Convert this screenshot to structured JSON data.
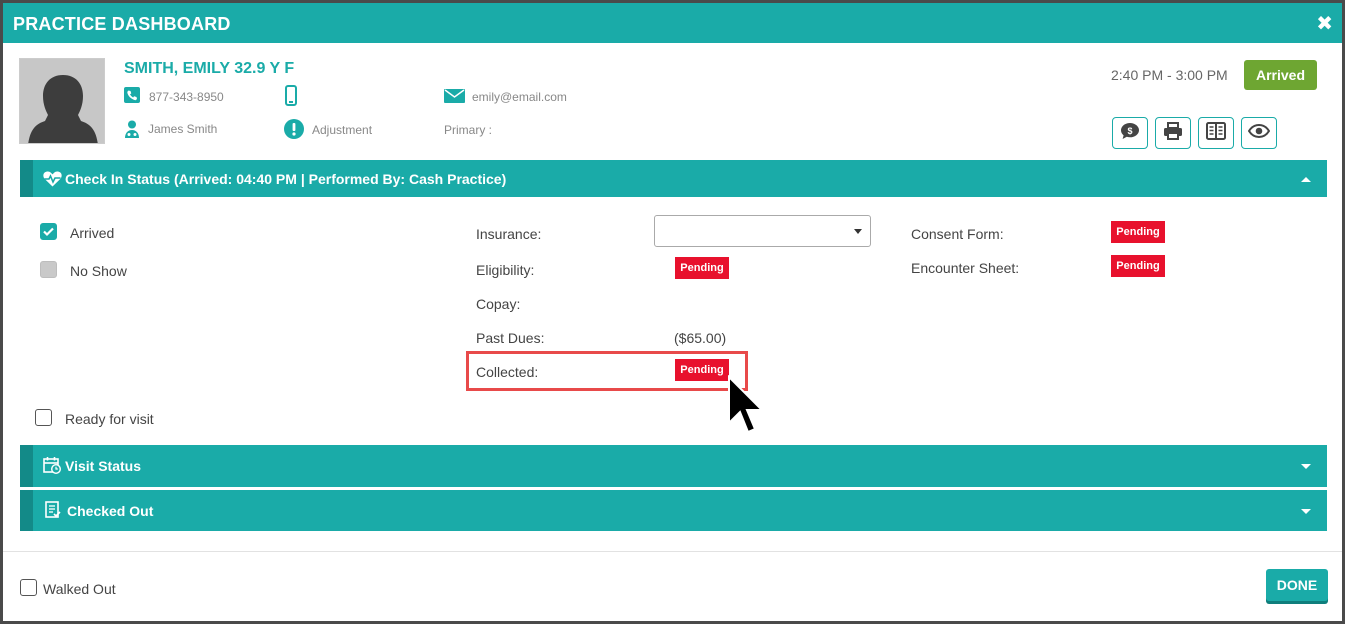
{
  "window": {
    "title": "PRACTICE DASHBOARD",
    "close_icon": "close-icon"
  },
  "patient": {
    "name": "SMITH, EMILY 32.9 Y F",
    "phone": "877-343-8950",
    "email": "emily@email.com",
    "provider": "James Smith",
    "alert_label": "Adjustment",
    "primary_label": "Primary :"
  },
  "appointment": {
    "time": "2:40 PM - 3:00 PM",
    "status": "Arrived",
    "status_color": "#6ea632"
  },
  "toolbar": {
    "buttons": [
      {
        "icon": "dollar-chat-icon"
      },
      {
        "icon": "printer-icon"
      },
      {
        "icon": "ledger-book-icon"
      },
      {
        "icon": "eye-icon"
      }
    ]
  },
  "sections": {
    "check_in": {
      "label": "Check In Status",
      "detail": "(Arrived: 04:40 PM | Performed By: Cash Practice)",
      "icon": "heart-pulse-icon",
      "expanded": true
    },
    "visit": {
      "label": "Visit Status",
      "icon": "calendar-clock-icon",
      "expanded": false
    },
    "checked_out": {
      "label": "Checked Out",
      "icon": "document-icon",
      "expanded": false
    }
  },
  "checkin": {
    "arrived": {
      "label": "Arrived",
      "checked": true
    },
    "no_show": {
      "label": "No Show",
      "checked": false
    },
    "ready": {
      "label": "Ready for visit",
      "checked": false
    },
    "insurance": {
      "label": "Insurance:",
      "value": ""
    },
    "eligibility": {
      "label": "Eligibility:",
      "badge": "Pending"
    },
    "copay": {
      "label": "Copay:",
      "value": ""
    },
    "past_dues": {
      "label": "Past Dues:",
      "value": "($65.00)"
    },
    "collected": {
      "label": "Collected:",
      "badge": "Pending"
    },
    "consent": {
      "label": "Consent Form:",
      "badge": "Pending"
    },
    "encounter": {
      "label": "Encounter Sheet:",
      "badge": "Pending"
    }
  },
  "footer": {
    "walked_out": {
      "label": "Walked Out",
      "checked": false
    },
    "done_label": "DONE"
  },
  "colors": {
    "teal": "#1aaba8",
    "pending": "#e8112d",
    "highlight": "#e84a4a"
  }
}
